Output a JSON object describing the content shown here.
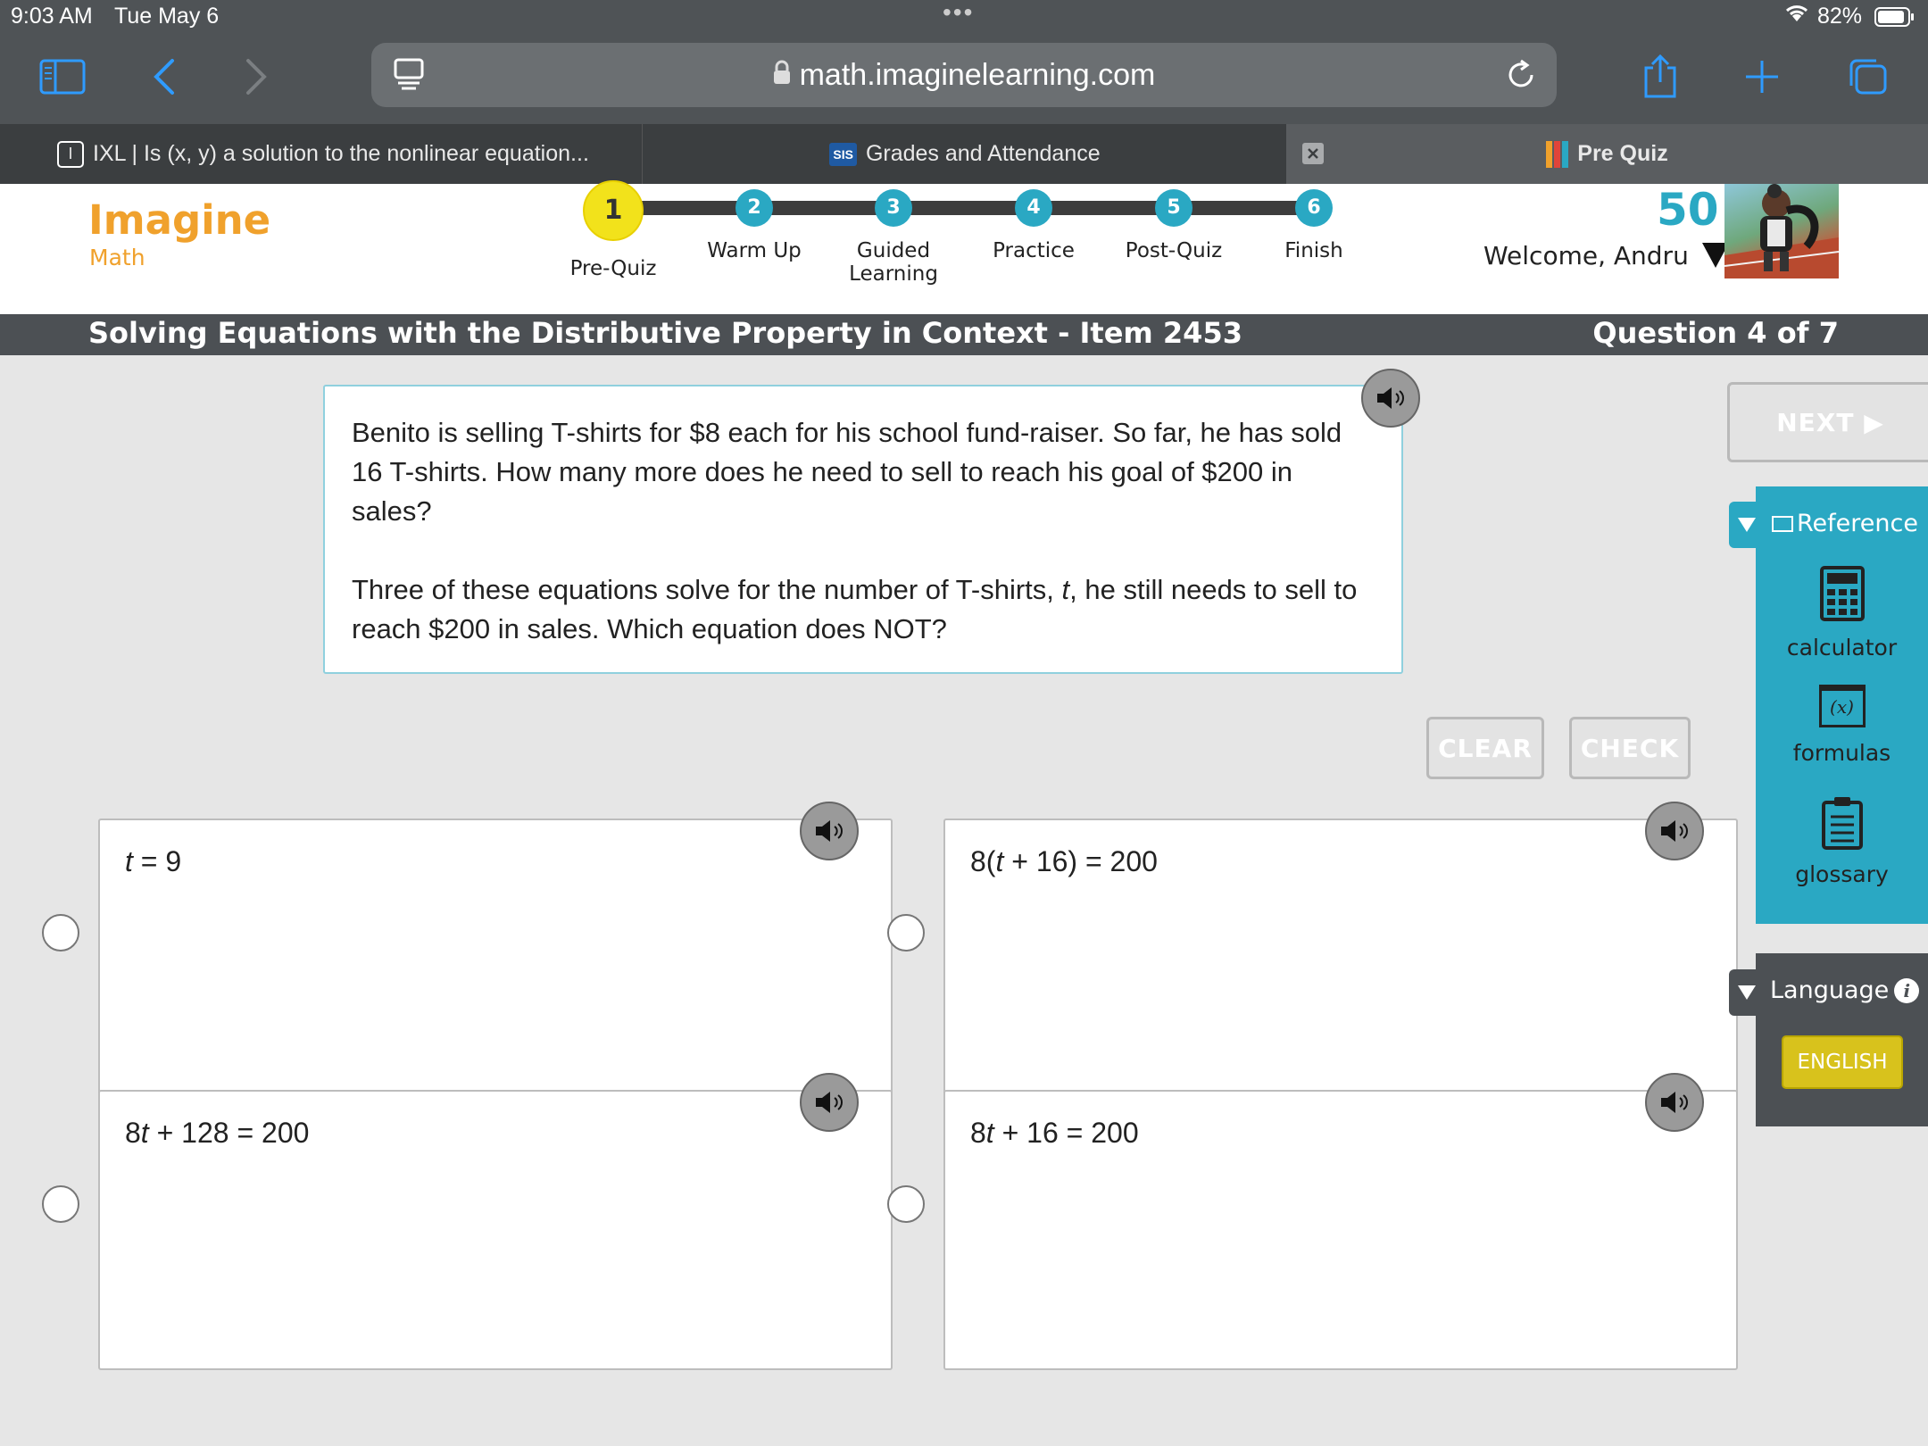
{
  "status": {
    "time": "9:03 AM",
    "date": "Tue May 6",
    "dots": "•••",
    "battery": "82%"
  },
  "browser": {
    "url": "math.imaginelearning.com"
  },
  "tabs": [
    {
      "label": "IXL | Is (x, y) a solution to the nonlinear equation...",
      "favicon": "I"
    },
    {
      "label": "Grades and Attendance",
      "favicon": "SIS"
    },
    {
      "label": "Pre Quiz"
    }
  ],
  "app": {
    "logo_top": "Imagine",
    "logo_bottom": "Math",
    "steps": [
      {
        "num": "1",
        "label": "Pre-Quiz"
      },
      {
        "num": "2",
        "label": "Warm Up"
      },
      {
        "num": "3",
        "label": "Guided Learning"
      },
      {
        "num": "4",
        "label": "Practice"
      },
      {
        "num": "5",
        "label": "Post-Quiz"
      },
      {
        "num": "6",
        "label": "Finish"
      }
    ],
    "current_step": 1,
    "score": "50",
    "welcome": "Welcome, Andru"
  },
  "lesson": {
    "title": "Solving Equations with the Distributive Property in Context - Item 2453",
    "question_count": "Question 4 of 7"
  },
  "question": {
    "p1": "Benito is selling T-shirts for $8 each for his school fund-raiser. So far, he has sold 16 T-shirts. How many more does he need to sell to reach his goal of $200 in sales?",
    "p2_a": "Three of these equations solve for the number of T-shirts, ",
    "p2_var": "t",
    "p2_b": ", he still needs to sell to reach $200 in sales. Which equation does NOT?"
  },
  "buttons": {
    "clear": "CLEAR",
    "check": "CHECK",
    "next": "NEXT ▶"
  },
  "answers": [
    {
      "pre": "",
      "var": "t",
      "post": " = 9"
    },
    {
      "pre": "8(",
      "var": "t",
      "post": " + 16) = 200"
    },
    {
      "pre": "8",
      "var": "t",
      "post": " + 128 = 200"
    },
    {
      "pre": "8",
      "var": "t",
      "post": " + 16 = 200"
    }
  ],
  "reference": {
    "title": "Reference",
    "tools": [
      "calculator",
      "formulas",
      "glossary"
    ],
    "formula_glyph": "(x)"
  },
  "language": {
    "title": "Language",
    "info": "i",
    "current": "ENGLISH"
  },
  "colors": {
    "accent": "#2aa8c3",
    "brand": "#f0a12c",
    "current_step": "#f2e21b",
    "header_bar": "#4c5054"
  }
}
